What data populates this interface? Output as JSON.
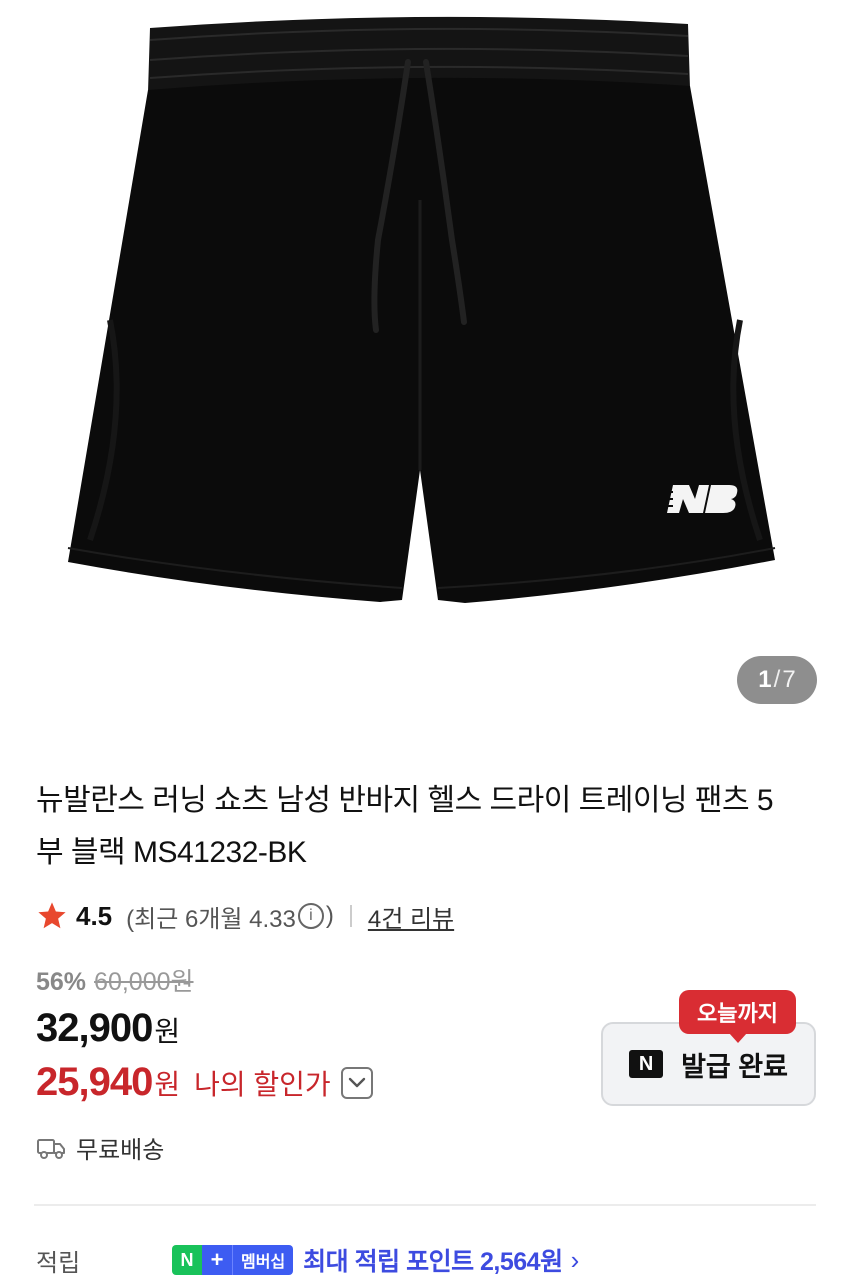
{
  "gallery": {
    "current": "1",
    "separator": "/",
    "total": "7"
  },
  "product": {
    "title": "뉴발란스 러닝 쇼츠 남성 반바지 헬스 드라이 트레이닝 팬츠 5부 블랙 MS41232-BK",
    "image_alt": "black running shorts with NB logo"
  },
  "rating": {
    "score": "4.5",
    "recent_prefix": "(최근 6개월 4.33",
    "recent_suffix": ")",
    "info_glyph": "i",
    "review_link": "4건 리뷰"
  },
  "pricing": {
    "discount": "56%",
    "original_price": "60,000원",
    "price": "32,900",
    "price_unit": "원",
    "my_price": "25,940",
    "my_price_unit": "원",
    "my_price_label": "나의 할인가"
  },
  "coupon": {
    "tag": "오늘까지",
    "logo": "N",
    "label": "발급 완료"
  },
  "shipping": {
    "label": "무료배송"
  },
  "points": {
    "label": "적립",
    "badge_n": "N",
    "badge_plus": "+",
    "badge_member": "멤버십",
    "text": "최대 적립 포인트 2,564원",
    "chevron": "›"
  },
  "colors": {
    "accent_red": "#c8262b",
    "tag_red": "#d92d33",
    "points_blue": "#3d4be0",
    "npay_green": "#19c25a",
    "star": "#e8482e"
  },
  "icons": [
    "star-icon",
    "info-icon",
    "chevron-down-icon",
    "truck-icon",
    "chevron-right-icon",
    "naver-n-logo"
  ]
}
